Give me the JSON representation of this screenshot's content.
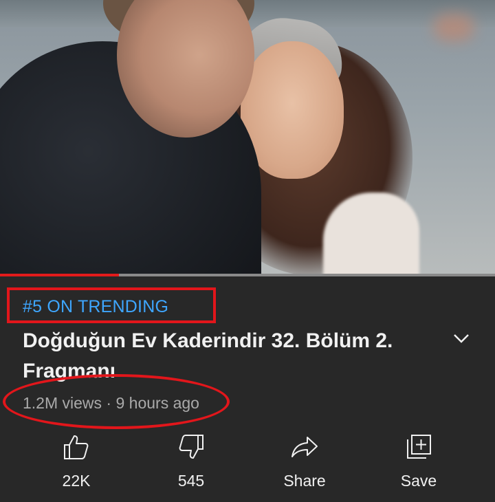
{
  "video": {
    "progress_fraction": 0.24
  },
  "trending": {
    "label": "#5 ON TRENDING",
    "color": "#3ea6ff"
  },
  "video_info": {
    "title": "Doğduğun Ev Kaderindir 32. Bölüm 2. Fragmanı",
    "meta": "1.2M views · 9 hours ago",
    "expand_icon": "chevron-down-icon"
  },
  "actions": {
    "like": {
      "icon": "thumbs-up-icon",
      "label": "22K"
    },
    "dislike": {
      "icon": "thumbs-down-icon",
      "label": "545"
    },
    "share": {
      "icon": "share-icon",
      "label": "Share"
    },
    "save": {
      "icon": "add-to-playlist-icon",
      "label": "Save"
    }
  },
  "colors": {
    "background": "#282828",
    "annotation_red": "#e2161b",
    "progress_red": "#e21b1b",
    "text_primary": "#f1f1f1",
    "text_secondary": "#aaaaaa"
  }
}
